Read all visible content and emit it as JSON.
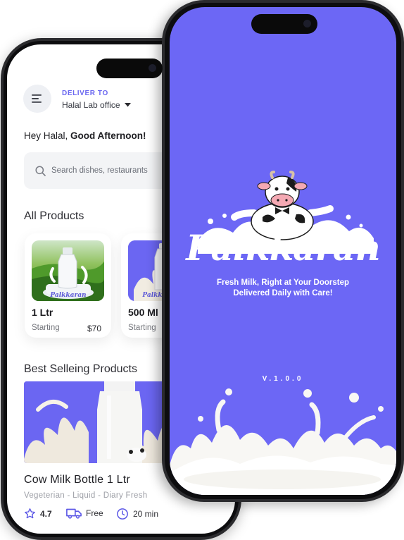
{
  "home": {
    "deliver_label": "DELIVER TO",
    "location": "Halal Lab office",
    "greeting_prefix": "Hey Halal,",
    "greeting_bold": "Good Afternoon!",
    "search_placeholder": "Search dishes, restaurants",
    "all_products_title": "All Products",
    "products": [
      {
        "size": "1 Ltr",
        "label": "Starting",
        "price": "$70"
      },
      {
        "size": "500 Ml",
        "label": "Starting",
        "price": ""
      }
    ],
    "best_selling_title": "Best Selleing Products",
    "featured": {
      "title": "Cow Milk Bottle 1 Ltr",
      "subtitle": "Vegeterian - Liquid - Diary Fresh",
      "rating": "4.7",
      "delivery": "Free",
      "time": "20 min"
    },
    "accent_color": "#6b66f2"
  },
  "splash": {
    "brand": "Palkkaran",
    "tagline_line1": "Fresh Milk, Right at Your Doorstep",
    "tagline_line2": "Delivered Daily with Care!",
    "version": "V.1.0.0",
    "background_color": "#6c67f5"
  }
}
